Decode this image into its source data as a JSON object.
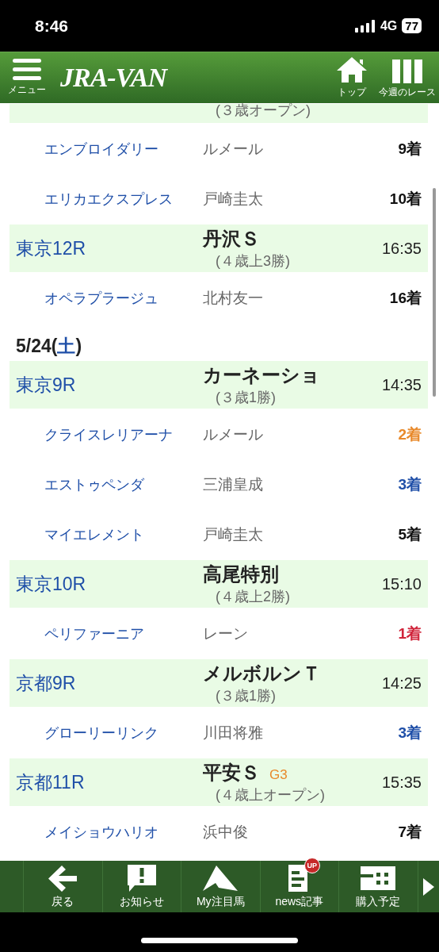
{
  "status_bar": {
    "time": "8:46",
    "network": "4G",
    "battery": "77"
  },
  "header": {
    "menu_label": "メニュー",
    "logo": "JRA-VAN",
    "actions": [
      {
        "label": "トップ",
        "kind": "home"
      },
      {
        "label": "今週のレース",
        "kind": "columns"
      }
    ]
  },
  "rows": [
    {
      "kind": "race",
      "class": "(３歳オープン)"
    },
    {
      "kind": "horse",
      "horse": "エンブロイダリー",
      "jockey": "ルメール",
      "result": "9着",
      "color": "#111111"
    },
    {
      "kind": "horse",
      "horse": "エリカエクスプレス",
      "jockey": "戸崎圭太",
      "result": "10着",
      "color": "#111111"
    },
    {
      "kind": "race",
      "venue": "東京12R",
      "name": "丹沢Ｓ",
      "class": "(４歳上3勝)",
      "time": "16:35"
    },
    {
      "kind": "horse",
      "horse": "オペラプラージュ",
      "jockey": "北村友一",
      "result": "16着",
      "color": "#111111"
    },
    {
      "kind": "date",
      "date": "5/24(",
      "weekday": "土",
      "close": ")"
    },
    {
      "kind": "race",
      "venue": "東京9R",
      "name": "カーネーショ",
      "class": "(３歳1勝)",
      "time": "14:35"
    },
    {
      "kind": "horse",
      "horse": "クライスレリアーナ",
      "jockey": "ルメール",
      "result": "2着",
      "color": "#e8892a"
    },
    {
      "kind": "horse",
      "horse": "エストゥペンダ",
      "jockey": "三浦皇成",
      "result": "3着",
      "color": "#1f4fa8"
    },
    {
      "kind": "horse",
      "horse": "マイエレメント",
      "jockey": "戸崎圭太",
      "result": "5着",
      "color": "#111111"
    },
    {
      "kind": "race",
      "venue": "東京10R",
      "name": "高尾特別",
      "class": "(４歳上2勝)",
      "time": "15:10"
    },
    {
      "kind": "horse",
      "horse": "ペリファーニア",
      "jockey": "レーン",
      "result": "1着",
      "color": "#d0243a"
    },
    {
      "kind": "race",
      "venue": "京都9R",
      "name": "メルボルンＴ",
      "class": "(３歳1勝)",
      "time": "14:25"
    },
    {
      "kind": "horse",
      "horse": "グローリーリンク",
      "jockey": "川田将雅",
      "result": "3着",
      "color": "#1f4fa8"
    },
    {
      "kind": "race",
      "venue": "京都11R",
      "name": "平安Ｓ",
      "grade": "G3",
      "class": "(４歳上オープン)",
      "time": "15:35"
    },
    {
      "kind": "horse",
      "horse": "メイショウハリオ",
      "jockey": "浜中俊",
      "result": "7着",
      "color": "#111111"
    }
  ],
  "footer": {
    "items": [
      {
        "label": "戻る",
        "kind": "back"
      },
      {
        "label": "お知らせ",
        "kind": "notice"
      },
      {
        "label": "My注目馬",
        "kind": "horse"
      },
      {
        "label": "news記事",
        "kind": "news",
        "badge": "UP"
      },
      {
        "label": "購入予定",
        "kind": "ticket"
      }
    ]
  }
}
